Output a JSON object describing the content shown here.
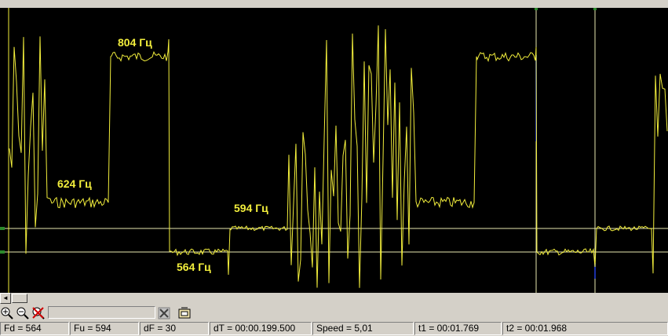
{
  "plot": {
    "background": "#000000",
    "signal_color": "#f2ee3c",
    "cursor_color": "#e8e8b0",
    "labels": {
      "f804": "804 Гц",
      "f624": "624 Гц",
      "f594": "594 Гц",
      "f564": "564 Гц"
    }
  },
  "scrollbar": {
    "left_arrow": "◄"
  },
  "toolbar": {
    "zoom_in_icon": "zoom-in-icon",
    "zoom_out_icon": "zoom-out-icon",
    "reset_icon": "cross-icon",
    "clear_icon": "clear-icon",
    "hand_icon": "hand-icon",
    "input_value": ""
  },
  "status": {
    "fd": "Fd = 564",
    "fu": "Fu = 594",
    "df": "dF = 30",
    "dt": "dT = 00:00.199.500",
    "speed": "Speed = 5,01",
    "t1": "t1 = 00:01.769",
    "t2": "t2 = 00:01.968"
  }
}
